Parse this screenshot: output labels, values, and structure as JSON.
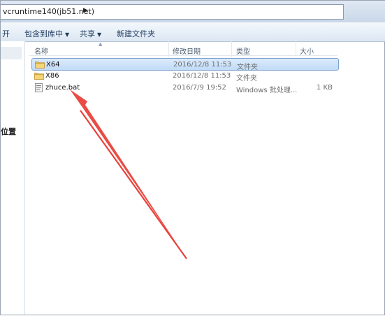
{
  "address": {
    "path": "vcruntime140(jb51.net)"
  },
  "toolbar": {
    "open_label": "开",
    "include_label": "包含到库中",
    "share_label": "共享",
    "new_folder_label": "新建文件夹"
  },
  "nav": {
    "partial_label": "位置"
  },
  "columns": {
    "name": "名称",
    "date": "修改日期",
    "type": "类型",
    "size": "大小"
  },
  "files": [
    {
      "name": "X64",
      "date": "2016/12/8 11:53",
      "type": "文件夹",
      "size": "",
      "icon": "folder-icon",
      "selected": true
    },
    {
      "name": "X86",
      "date": "2016/12/8 11:53",
      "type": "文件夹",
      "size": "",
      "icon": "folder-icon",
      "selected": false
    },
    {
      "name": "zhuce.bat",
      "date": "2016/7/9 19:52",
      "type": "Windows 批处理...",
      "size": "1 KB",
      "icon": "batch-file-icon",
      "selected": false
    }
  ],
  "colors": {
    "annotation_arrow": "#e8423b",
    "selection": "#c9e0f8",
    "folder": "#e9c25a"
  }
}
